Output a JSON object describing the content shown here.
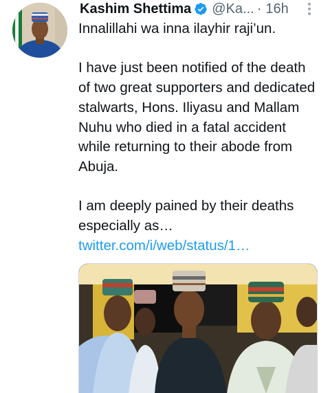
{
  "tweet": {
    "author_name": "Kashim Shettima",
    "handle": "@Ka...",
    "separator": "·",
    "time": "16h",
    "lines": {
      "l1": "Innalillahi wa inna ilayhir raji’un.",
      "p2": "I have just been notified of the death of two great supporters and dedicated stalwarts, Hons. Iliyasu and Mallam Nuhu who died in a fatal accident while returning to their abode from Abuja.",
      "p3_text": "I am deeply pained by their deaths especially as… ",
      "p3_link": "twitter.com/i/web/status/1…"
    }
  },
  "icons": {
    "verified": "verified-badge-icon",
    "more": "more-options-icon"
  },
  "colors": {
    "text": "#0f1419",
    "secondary": "#536471",
    "link": "#1d9bf0",
    "verified": "#1d9bf0"
  }
}
